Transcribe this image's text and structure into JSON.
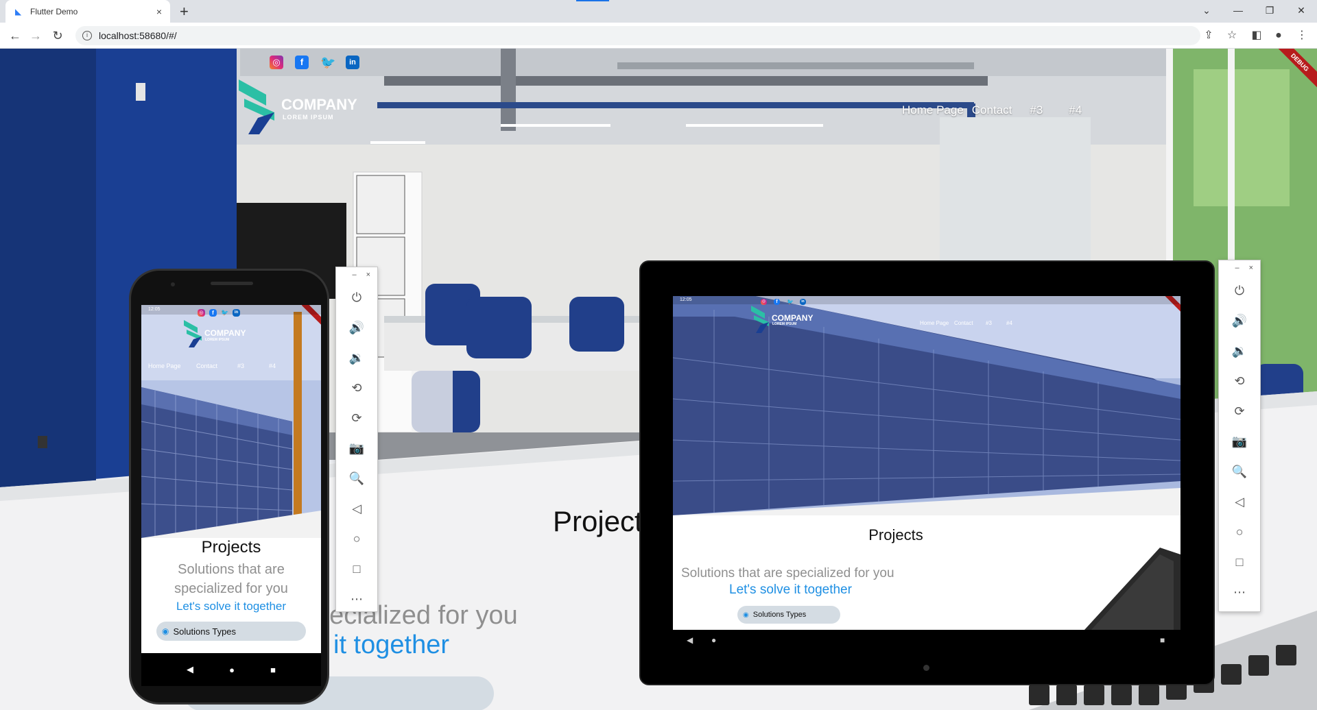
{
  "browser": {
    "tab_title": "Flutter Demo",
    "tab_close": "×",
    "new_tab": "+",
    "url": "localhost:58680/#/",
    "window_controls": [
      "⌄",
      "—",
      "❐",
      "✕"
    ]
  },
  "site": {
    "logo_main": "COMPANY",
    "logo_sub": "LOREM IPSUM",
    "social": [
      "instagram-icon",
      "facebook-icon",
      "twitter-icon",
      "linkedin-icon"
    ],
    "nav": [
      "Home Page",
      "Contact",
      "#3",
      "#4"
    ],
    "debug_banner": "DEBUG",
    "projects_title": "Projects",
    "tagline": "Solutions that are specialized for you",
    "tagline_visible": "specialized for you",
    "cta": "Let's solve it together",
    "cta_visible": "it together",
    "solutions_types": "Solutions Types"
  },
  "phone": {
    "status_time": "12:05",
    "projects_title": "Projects",
    "tagline_line1": "Solutions that are",
    "tagline_line2": "specialized for you",
    "cta": "Let's solve it together",
    "solutions_types": "Solutions Types",
    "nav_buttons": [
      "◀",
      "●",
      "■"
    ]
  },
  "tablet": {
    "status_time": "12:05",
    "projects_title": "Projects",
    "tagline": "Solutions that are specialized for you",
    "cta": "Let's solve it together",
    "solutions_types": "Solutions Types",
    "nav_buttons": [
      "◀",
      "●",
      "■"
    ]
  },
  "emulator_panel": {
    "minimize": "–",
    "close": "×",
    "buttons": [
      "power-icon",
      "volume-up-icon",
      "volume-down-icon",
      "rotate-left-icon",
      "rotate-right-icon",
      "camera-icon",
      "zoom-icon",
      "back-icon",
      "home-icon",
      "overview-icon",
      "more-icon"
    ],
    "glyphs": [
      "⏻",
      "🔊",
      "🔉",
      "⟲",
      "⟳",
      "📷",
      "🔍",
      "◁",
      "○",
      "□",
      "⋯"
    ]
  },
  "colors": {
    "accent_blue": "#1e8fe3",
    "tagline_gray": "#8f8f8f",
    "logo_teal": "#2bbfa5",
    "debug_red": "#b71c1c"
  }
}
